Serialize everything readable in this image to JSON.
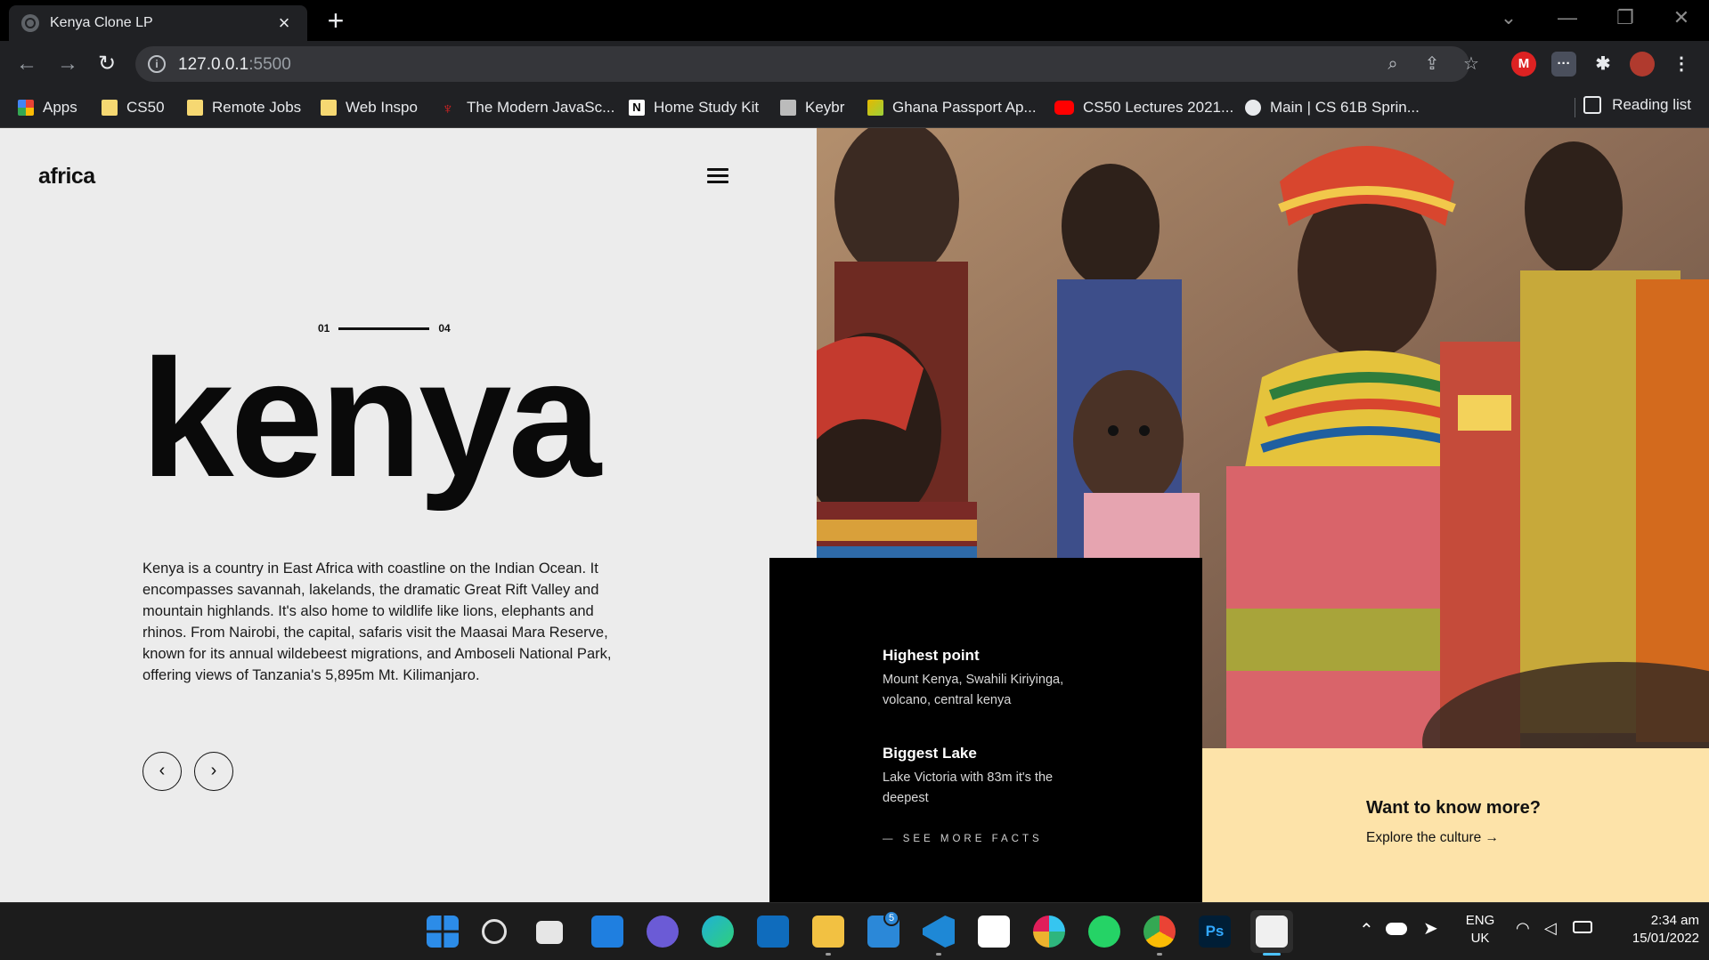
{
  "browser": {
    "tab_title": "Kenya Clone LP",
    "new_tab": "+",
    "url_host": "127.0.0.1",
    "url_port": ":5500",
    "bookmarks": [
      {
        "label": "Apps",
        "icon": "apps-grid-icon"
      },
      {
        "label": "CS50",
        "icon": "folder-icon"
      },
      {
        "label": "Remote Jobs",
        "icon": "folder-icon"
      },
      {
        "label": "Web Inspo",
        "icon": "folder-icon"
      },
      {
        "label": "The Modern JavaSc...",
        "icon": "javascript-site-icon"
      },
      {
        "label": "Home Study Kit",
        "icon": "notion-icon"
      },
      {
        "label": "Keybr",
        "icon": "keybr-icon"
      },
      {
        "label": "Ghana Passport Ap...",
        "icon": "ghana-passport-icon"
      },
      {
        "label": "CS50 Lectures 2021...",
        "icon": "youtube-icon"
      },
      {
        "label": "Main | CS 61B Sprin...",
        "icon": "globe-icon"
      }
    ],
    "reading_list": "Reading list"
  },
  "page": {
    "logo": "africa",
    "pager_start": "01",
    "pager_end": "04",
    "headline": "kenya",
    "description": "Kenya is a country in East Africa with coastline on the Indian Ocean. It encompasses savannah, lakelands, the dramatic Great Rift Valley and mountain highlands. It's also home to wildlife like lions, elephants and rhinos. From Nairobi, the capital, safaris visit the Maasai Mara Reserve, known for its annual wildebeest migrations, and Amboseli National Park, offering views of Tanzania's 5,895m Mt. Kilimanjaro.",
    "prev_arrow": "‹",
    "next_arrow": "›",
    "facts": [
      {
        "title": "Highest point",
        "text": "Mount Kenya, Swahili Kiriyinga, volcano, central kenya"
      },
      {
        "title": "Biggest Lake",
        "text": "Lake Victoria with 83m it's the deepest"
      }
    ],
    "see_more": "— SEE MORE FACTS",
    "cta_title": "Want to know more?",
    "cta_link": "Explore the culture →"
  },
  "taskbar": {
    "teams_badge": "5",
    "language": "ENG",
    "region": "UK",
    "time": "2:34 am",
    "date": "15/01/2022"
  },
  "colors": {
    "page_bg": "#ececec",
    "facts_bg": "#000000",
    "cta_bg": "#fde3a9",
    "chrome_bg": "#202124"
  }
}
